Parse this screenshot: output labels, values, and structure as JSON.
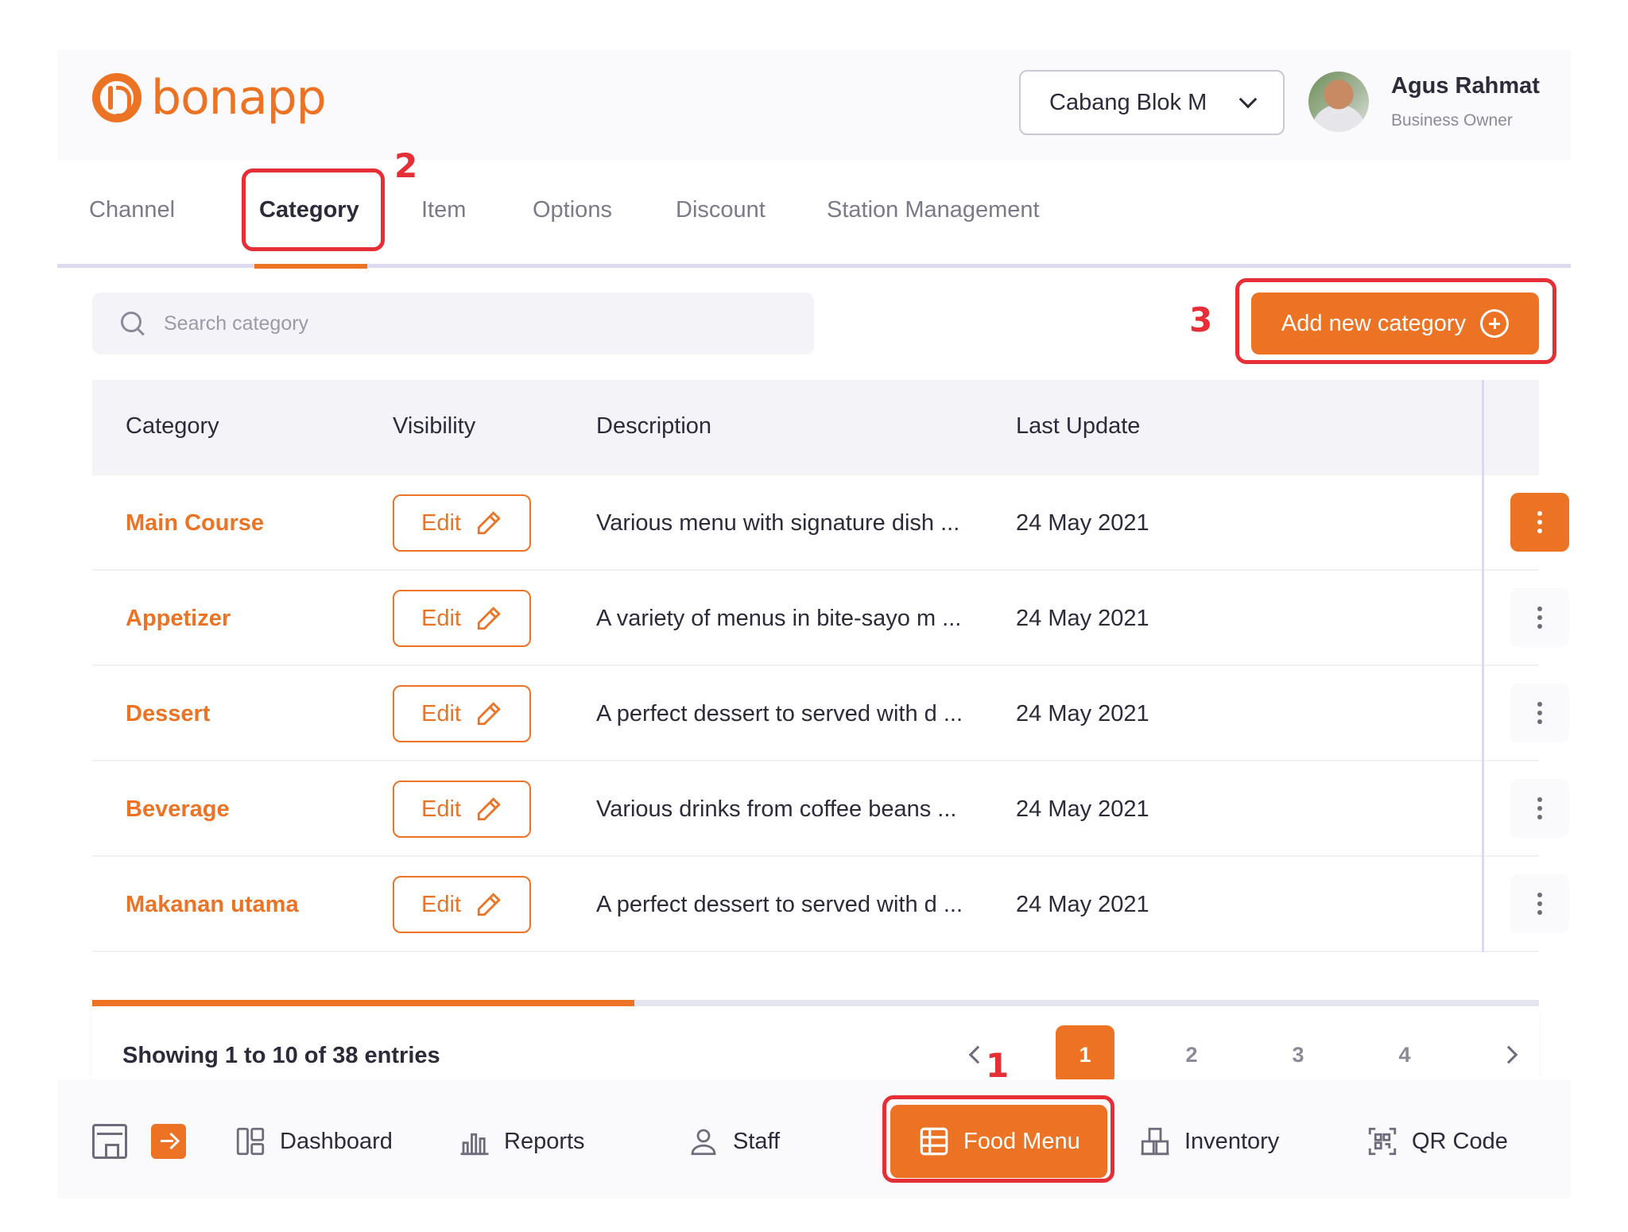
{
  "brand": {
    "name": "bonapp",
    "color": "#ec7224"
  },
  "header": {
    "branch_selector": "Cabang Blok M",
    "user": {
      "name": "Agus Rahmat",
      "role": "Business Owner"
    }
  },
  "tabs": [
    {
      "label": "Channel",
      "active": false
    },
    {
      "label": "Category",
      "active": true
    },
    {
      "label": "Item",
      "active": false
    },
    {
      "label": "Options",
      "active": false
    },
    {
      "label": "Discount",
      "active": false
    },
    {
      "label": "Station Management",
      "active": false
    }
  ],
  "toolbar": {
    "search_placeholder": "Search category",
    "search_value": "",
    "add_button": "Add new category"
  },
  "table": {
    "columns": [
      "Category",
      "Visibility",
      "Description",
      "Last Update"
    ],
    "rows": [
      {
        "category": "Main Course",
        "visibility_action": "Edit",
        "description": "Various menu with signature dish ...",
        "last_update": "24 May 2021"
      },
      {
        "category": "Appetizer",
        "visibility_action": "Edit",
        "description": "A variety of menus in bite-sayo m ...",
        "last_update": "24 May 2021"
      },
      {
        "category": "Dessert",
        "visibility_action": "Edit",
        "description": "A perfect dessert to served with d ...",
        "last_update": "24 May 2021"
      },
      {
        "category": "Beverage",
        "visibility_action": "Edit",
        "description": "Various drinks from coffee beans ...",
        "last_update": "24 May 2021"
      },
      {
        "category": "Makanan utama",
        "visibility_action": "Edit",
        "description": "A perfect dessert to served with d ...",
        "last_update": "24 May 2021"
      }
    ]
  },
  "pagination": {
    "entries_text": "Showing 1 to 10 of 38 entries",
    "pages": [
      "1",
      "2",
      "3",
      "4"
    ],
    "current_page": "1"
  },
  "bottom_nav": [
    {
      "label": "Dashboard",
      "icon": "dashboard-icon",
      "active": false
    },
    {
      "label": "Reports",
      "icon": "bar-chart-icon",
      "active": false
    },
    {
      "label": "Staff",
      "icon": "user-icon",
      "active": false
    },
    {
      "label": "Food Menu",
      "icon": "food-menu-icon",
      "active": true
    },
    {
      "label": "Inventory",
      "icon": "inventory-icon",
      "active": false
    },
    {
      "label": "QR Code",
      "icon": "qr-code-icon",
      "active": false
    }
  ],
  "annotations": [
    "1",
    "2",
    "3"
  ],
  "colors": {
    "accent": "#ec7224",
    "annotation": "#e62e36",
    "text": "#2b2b3a",
    "muted": "#8a8a99"
  }
}
